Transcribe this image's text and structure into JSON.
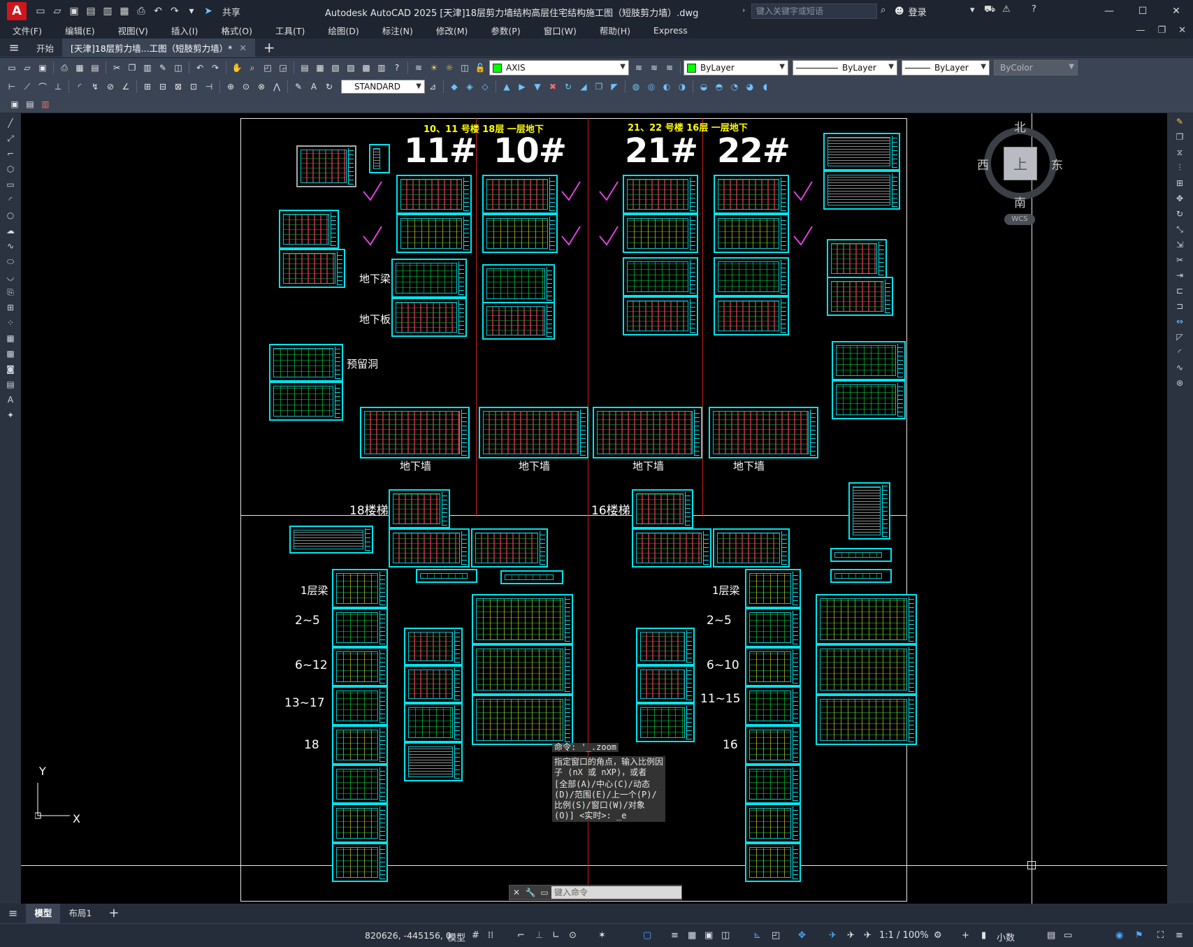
{
  "app": {
    "title": "Autodesk AutoCAD 2025    [天津]18层剪力墙结构高层住宅结构施工图（短肢剪力墙）.dwg",
    "search_placeholder": "键入关键字或短语",
    "login": "登录",
    "share": "共享"
  },
  "menu": [
    "文件(F)",
    "编辑(E)",
    "视图(V)",
    "插入(I)",
    "格式(O)",
    "工具(T)",
    "绘图(D)",
    "标注(N)",
    "修改(M)",
    "参数(P)",
    "窗口(W)",
    "帮助(H)",
    "Express"
  ],
  "tabs": {
    "start": "开始",
    "doc": "[天津]18层剪力墙...工图（短肢剪力墙）*"
  },
  "toolbar": {
    "layer": "AXIS",
    "color": "ByLayer",
    "linetype": "ByLayer",
    "lineweight": "ByLayer",
    "plotstyle": "ByColor",
    "textstyle": "STANDARD"
  },
  "colors": {
    "accent_cyan": "#00e5ee",
    "drawing_green": "#00ff50",
    "check_magenta": "#e040e0",
    "divider_red": "#c82020",
    "label_yellow": "#ffff00"
  },
  "drawing": {
    "top_left_title": "10、11 号楼 18层 一层地下",
    "top_right_title": "21、22 号楼 16层 一层地下",
    "buildings": [
      "11#",
      "10#",
      "21#",
      "22#"
    ],
    "labels": {
      "underground_beam": "地下梁",
      "underground_slab": "地下板",
      "reserved_hole": "预留洞",
      "underground_wall": "地下墙",
      "stair18": "18楼梯",
      "stair16": "16楼梯",
      "floor1_beam": "1层梁"
    },
    "left_floors": [
      "2~5",
      "6~12",
      "13~17",
      "18"
    ],
    "right_floors": [
      "2~5",
      "6~10",
      "11~15",
      "16"
    ]
  },
  "compass": {
    "north": "北",
    "south": "南",
    "east": "东",
    "west": "西",
    "top": "上",
    "wcs": "WCS"
  },
  "ucs": {
    "y": "Y",
    "x": "X"
  },
  "command": {
    "history": [
      "命令: '_.zoom",
      "指定窗口的角点，输入比例因子 (nX 或 nXP)，或者",
      "[全部(A)/中心(C)/动态(D)/范围(E)/上一个(P)/比例(S)/窗口(W)/对象(O)] <实时>: _e"
    ],
    "placeholder": "键入命令"
  },
  "layout_tabs": [
    "模型",
    "布局1"
  ],
  "status": {
    "coords": "820626, -445156, 0",
    "model": "模型",
    "scale": "1:1 / 100%",
    "units": "小数"
  }
}
